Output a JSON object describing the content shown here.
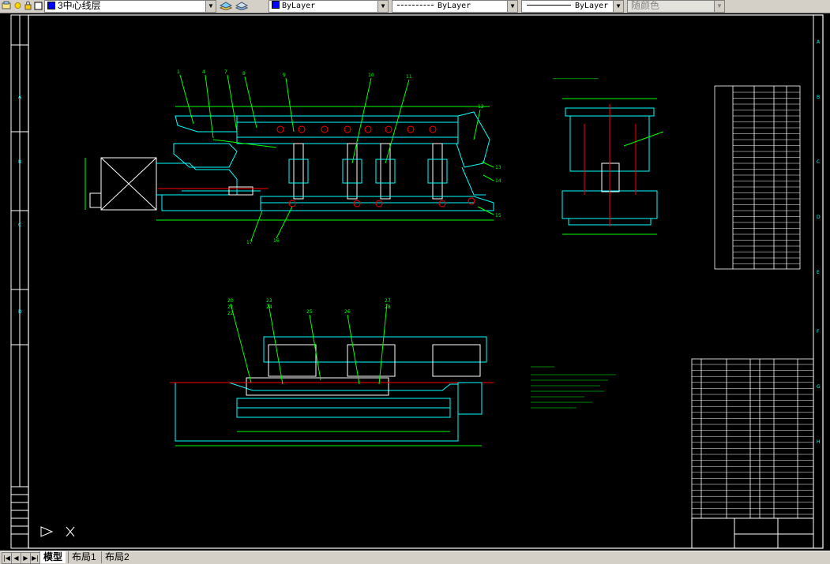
{
  "toolbar": {
    "layer": {
      "name": "3中心线层"
    },
    "color": {
      "value": "ByLayer"
    },
    "linetype": {
      "value": "ByLayer"
    },
    "lineweight": {
      "value": "ByLayer"
    },
    "plotstyle": {
      "value": "随颜色"
    },
    "swatch_color": "#0000ff"
  },
  "layout_tabs": [
    "模型",
    "布局1",
    "布局2"
  ],
  "active_tab": "模型",
  "drawing": {
    "colors": {
      "frame": "#ffffff",
      "outline": "#00ffff",
      "part": "#ffffff",
      "center": "#ff0000",
      "dim": "#00ff00",
      "label": "#ffff00",
      "table": "#ffffff",
      "callout": "#00ff00"
    },
    "part_numbers_main": [
      "1",
      "4",
      "7",
      "8",
      "9",
      "10",
      "11",
      "12",
      "13",
      "14",
      "15",
      "16",
      "17"
    ],
    "part_numbers_plan": [
      "20",
      "21",
      "22",
      "23",
      "24",
      "25",
      "26",
      "27",
      "28"
    ],
    "frame_zone_letters": [
      "A",
      "B",
      "C",
      "D",
      "E",
      "F",
      "G",
      "H"
    ]
  }
}
